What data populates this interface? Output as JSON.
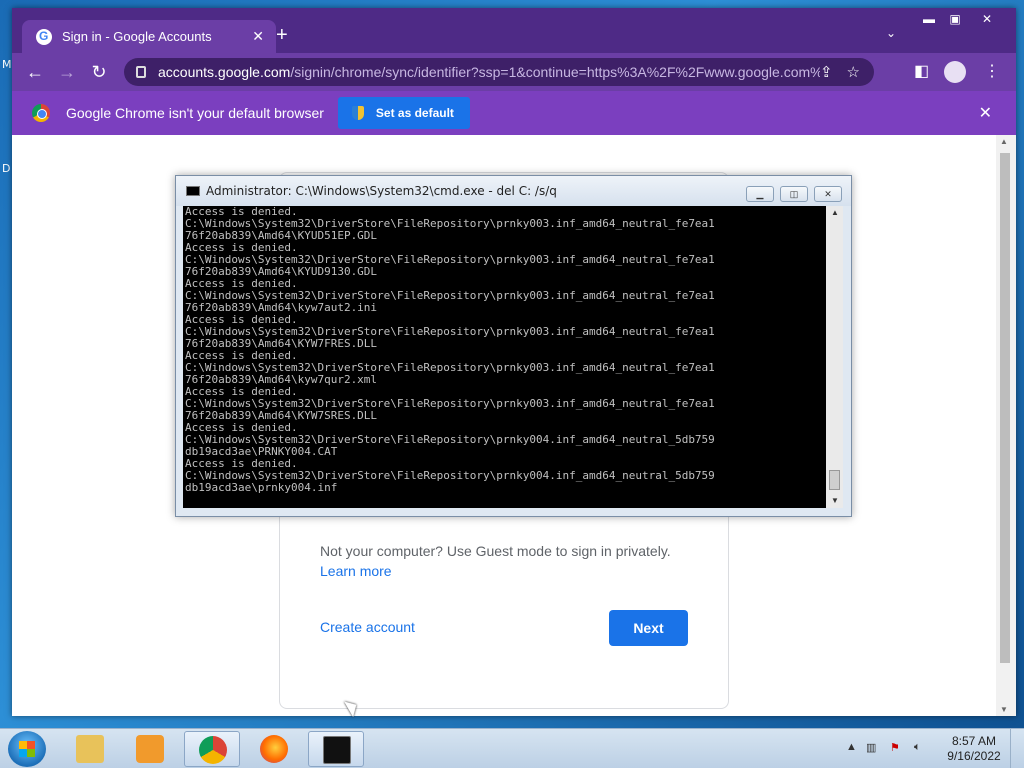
{
  "desktop": {
    "edge_letters": [
      "M",
      "D"
    ]
  },
  "browser": {
    "tab_title": "Sign in - Google Accounts",
    "url_host": "accounts.google.com",
    "url_path": "/signin/chrome/sync/identifier?ssp=1&continue=https%3A%2F%2Fwww.google.com%...",
    "infobar_text": "Google Chrome isn't your default browser",
    "infobar_button": "Set as default",
    "accent_color": "#6b3ea6"
  },
  "signin": {
    "guest_text": "Not your computer? Use Guest mode to sign in privately.",
    "learn_more": "Learn more",
    "create_account": "Create account",
    "next": "Next"
  },
  "cmd": {
    "title": "Administrator: C:\\Windows\\System32\\cmd.exe - del  C: /s/q",
    "lines": [
      "Access is denied.",
      "C:\\Windows\\System32\\DriverStore\\FileRepository\\prnky003.inf_amd64_neutral_fe7ea1",
      "76f20ab839\\Amd64\\KYUD51EP.GDL",
      "Access is denied.",
      "C:\\Windows\\System32\\DriverStore\\FileRepository\\prnky003.inf_amd64_neutral_fe7ea1",
      "76f20ab839\\Amd64\\KYUD9130.GDL",
      "Access is denied.",
      "C:\\Windows\\System32\\DriverStore\\FileRepository\\prnky003.inf_amd64_neutral_fe7ea1",
      "76f20ab839\\Amd64\\kyw7aut2.ini",
      "Access is denied.",
      "C:\\Windows\\System32\\DriverStore\\FileRepository\\prnky003.inf_amd64_neutral_fe7ea1",
      "76f20ab839\\Amd64\\KYW7FRES.DLL",
      "Access is denied.",
      "C:\\Windows\\System32\\DriverStore\\FileRepository\\prnky003.inf_amd64_neutral_fe7ea1",
      "76f20ab839\\Amd64\\kyw7qur2.xml",
      "Access is denied.",
      "C:\\Windows\\System32\\DriverStore\\FileRepository\\prnky003.inf_amd64_neutral_fe7ea1",
      "76f20ab839\\Amd64\\KYW7SRES.DLL",
      "Access is denied.",
      "C:\\Windows\\System32\\DriverStore\\FileRepository\\prnky004.inf_amd64_neutral_5db759",
      "db19acd3ae\\PRNKY004.CAT",
      "Access is denied.",
      "C:\\Windows\\System32\\DriverStore\\FileRepository\\prnky004.inf_amd64_neutral_5db759",
      "db19acd3ae\\prnky004.inf"
    ]
  },
  "taskbar": {
    "time": "8:57 AM",
    "date": "9/16/2022",
    "apps": [
      "file-explorer",
      "media-player",
      "chrome",
      "firefox",
      "cmd"
    ]
  }
}
